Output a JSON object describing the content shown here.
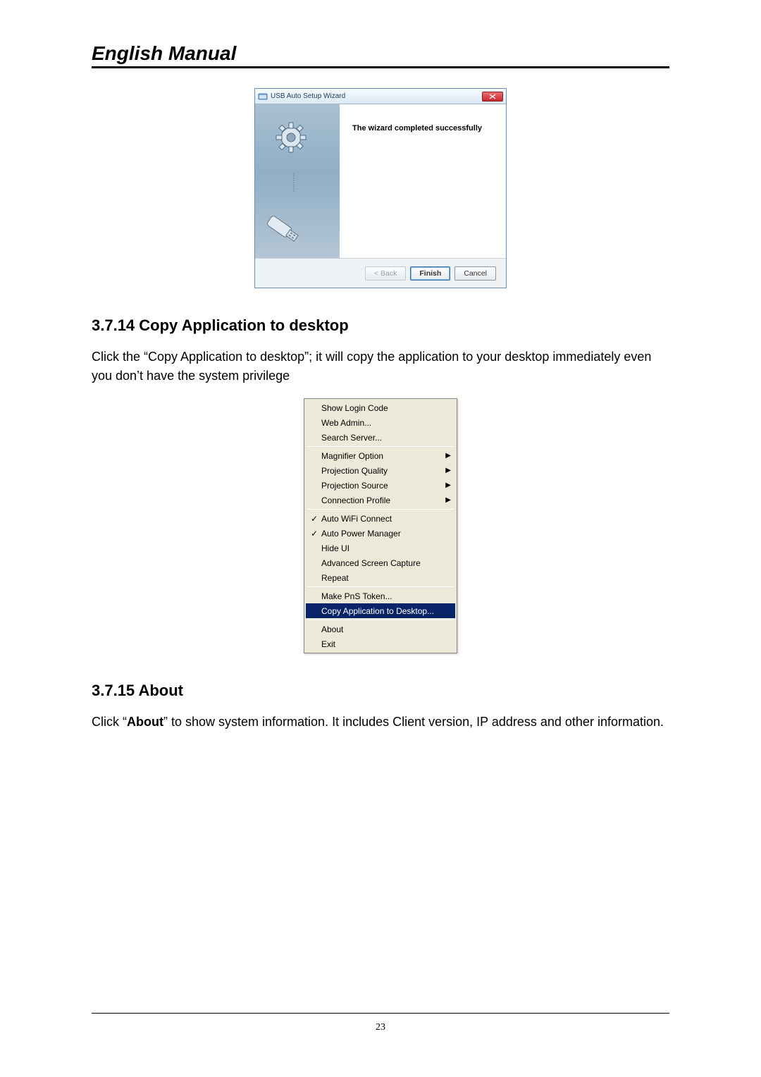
{
  "doc_title": "English Manual",
  "wizard": {
    "window_title": "USB Auto Setup Wizard",
    "message": "The wizard completed successfully",
    "back_label": "< Back",
    "finish_label": "Finish",
    "cancel_label": "Cancel"
  },
  "section1": {
    "heading": "3.7.14 Copy Application to desktop",
    "para": "Click the “Copy Application to desktop”; it will copy the application to your desktop immediately even you don’t have the system privilege"
  },
  "menu": {
    "groups": [
      {
        "items": [
          {
            "label": "Show Login Code",
            "checked": false,
            "submenu": false,
            "highlight": false
          },
          {
            "label": "Web Admin...",
            "checked": false,
            "submenu": false,
            "highlight": false
          },
          {
            "label": "Search Server...",
            "checked": false,
            "submenu": false,
            "highlight": false
          }
        ]
      },
      {
        "items": [
          {
            "label": "Magnifier Option",
            "checked": false,
            "submenu": true,
            "highlight": false
          },
          {
            "label": "Projection Quality",
            "checked": false,
            "submenu": true,
            "highlight": false
          },
          {
            "label": "Projection Source",
            "checked": false,
            "submenu": true,
            "highlight": false
          },
          {
            "label": "Connection Profile",
            "checked": false,
            "submenu": true,
            "highlight": false
          }
        ]
      },
      {
        "items": [
          {
            "label": "Auto WiFi Connect",
            "checked": true,
            "submenu": false,
            "highlight": false
          },
          {
            "label": "Auto Power Manager",
            "checked": true,
            "submenu": false,
            "highlight": false
          },
          {
            "label": "Hide UI",
            "checked": false,
            "submenu": false,
            "highlight": false
          },
          {
            "label": "Advanced Screen Capture",
            "checked": false,
            "submenu": false,
            "highlight": false
          },
          {
            "label": "Repeat",
            "checked": false,
            "submenu": false,
            "highlight": false
          }
        ]
      },
      {
        "items": [
          {
            "label": "Make PnS Token...",
            "checked": false,
            "submenu": false,
            "highlight": false
          },
          {
            "label": "Copy Application to Desktop...",
            "checked": false,
            "submenu": false,
            "highlight": true
          }
        ]
      },
      {
        "items": [
          {
            "label": "About",
            "checked": false,
            "submenu": false,
            "highlight": false
          },
          {
            "label": "Exit",
            "checked": false,
            "submenu": false,
            "highlight": false
          }
        ]
      }
    ]
  },
  "section2": {
    "heading": "3.7.15 About",
    "para_pre": "Click “",
    "para_bold": "About",
    "para_post": "” to show system information.   It includes Client version, IP address and other information."
  },
  "page_number": "23"
}
